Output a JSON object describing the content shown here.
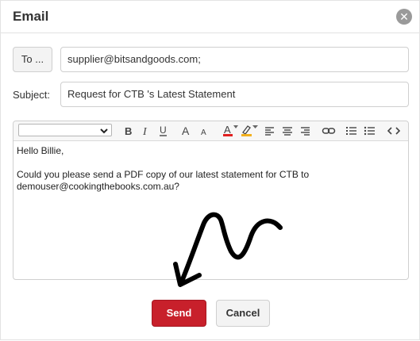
{
  "dialog": {
    "title": "Email",
    "close_icon": "close-icon"
  },
  "form": {
    "to_button_label": "To ...",
    "to_value": "supplier@bitsandgoods.com;",
    "subject_label": "Subject:",
    "subject_value": "Request for CTB 's Latest Statement"
  },
  "editor": {
    "format_select_value": "",
    "toolbar_icons": [
      "bold-icon",
      "italic-icon",
      "underline-icon",
      "font-size-increase-icon",
      "font-size-decrease-icon",
      "font-color-icon",
      "highlight-color-icon",
      "align-left-icon",
      "align-center-icon",
      "align-right-icon",
      "link-icon",
      "ordered-list-icon",
      "bulleted-list-icon",
      "code-view-icon"
    ],
    "body_lines": [
      "Hello Billie,",
      "",
      "Could you please send a PDF copy of our latest statement for CTB to",
      "demouser@cookingthebooks.com.au?"
    ]
  },
  "actions": {
    "send_label": "Send",
    "cancel_label": "Cancel"
  },
  "colors": {
    "send_button": "#c8202b",
    "font_color_bar": "#e02020",
    "highlight_bar": "#f2b01e",
    "annotation_arrow": "#000000"
  }
}
